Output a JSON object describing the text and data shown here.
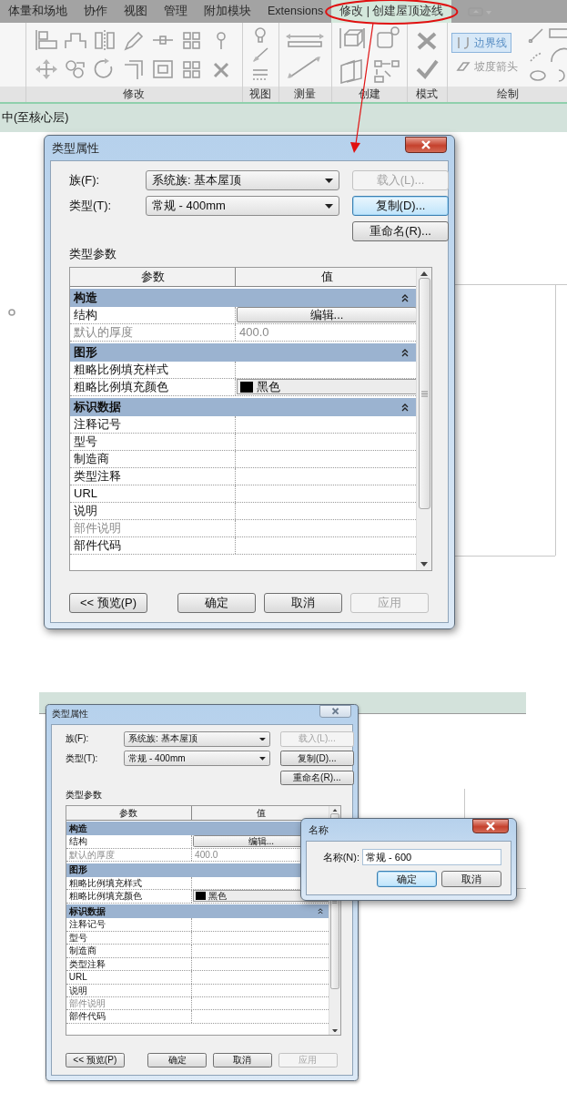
{
  "ribbon": {
    "tabs": [
      {
        "label": "体量和场地",
        "selected": false
      },
      {
        "label": "协作",
        "selected": false
      },
      {
        "label": "视图",
        "selected": false
      },
      {
        "label": "管理",
        "selected": false
      },
      {
        "label": "附加模块",
        "selected": false
      },
      {
        "label": "Extensions",
        "selected": false
      },
      {
        "label": "修改 | 创建屋顶迹线",
        "selected": true
      }
    ],
    "groups": [
      {
        "kind": "modify",
        "label": "修改"
      },
      {
        "kind": "view",
        "label": "视图"
      },
      {
        "kind": "measure",
        "label": "测量"
      },
      {
        "kind": "create",
        "label": "创建"
      },
      {
        "kind": "mode",
        "label": "模式"
      },
      {
        "kind": "draw",
        "label": "绘制"
      }
    ],
    "draw_tools": [
      {
        "label": "边界线",
        "selected": true
      },
      {
        "label": "坡度箭头",
        "selected": false
      }
    ]
  },
  "options_bar": {
    "text": "中(至核心层)"
  },
  "dialogs": [
    {
      "title": "类型属性",
      "active": true,
      "family": {
        "label": "族(F):",
        "value": "系统族: 基本屋顶"
      },
      "type": {
        "label": "类型(T):",
        "value": "常规 - 400mm"
      },
      "side_buttons": [
        {
          "label": "载入(L)...",
          "disabled": true,
          "focused": false
        },
        {
          "label": "复制(D)...",
          "disabled": false,
          "focused": true
        },
        {
          "label": "重命名(R)...",
          "disabled": false,
          "focused": false
        }
      ],
      "params_label": "类型参数",
      "columns": [
        "参数",
        "值"
      ],
      "sections": [
        {
          "name": "构造",
          "expanded": true,
          "rows": [
            {
              "name": "结构",
              "kind": "button",
              "value": "编辑...",
              "disabled": false
            },
            {
              "name": "默认的厚度",
              "kind": "text",
              "value": "400.0",
              "disabled": true
            }
          ]
        },
        {
          "name": "图形",
          "expanded": true,
          "rows": [
            {
              "name": "粗略比例填充样式",
              "kind": "text",
              "disabled": false
            },
            {
              "name": "粗略比例填充颜色",
              "kind": "color",
              "value": "黑色",
              "color": "#000000",
              "disabled": false
            }
          ]
        },
        {
          "name": "标识数据",
          "expanded": true,
          "rows": [
            {
              "name": "注释记号",
              "kind": "text",
              "disabled": false
            },
            {
              "name": "型号",
              "kind": "text",
              "disabled": false
            },
            {
              "name": "制造商",
              "kind": "text",
              "disabled": false
            },
            {
              "name": "类型注释",
              "kind": "text",
              "disabled": false
            },
            {
              "name": "URL",
              "kind": "text",
              "disabled": false
            },
            {
              "name": "说明",
              "kind": "text",
              "disabled": false
            },
            {
              "name": "部件说明",
              "kind": "text",
              "disabled": true
            },
            {
              "name": "部件代码",
              "kind": "text",
              "disabled": false
            }
          ]
        }
      ],
      "footer_buttons": [
        {
          "label": "<< 预览(P)",
          "disabled": false
        },
        {
          "label": "确定",
          "disabled": false
        },
        {
          "label": "取消",
          "disabled": false
        },
        {
          "label": "应用",
          "disabled": true
        }
      ]
    },
    {
      "title": "类型属性",
      "active": false,
      "family": {
        "label": "族(F):",
        "value": "系统族: 基本屋顶"
      },
      "type": {
        "label": "类型(T):",
        "value": "常规 - 400mm"
      },
      "side_buttons": [
        {
          "label": "载入(L)...",
          "disabled": true,
          "focused": false
        },
        {
          "label": "复制(D)...",
          "disabled": false,
          "focused": false
        },
        {
          "label": "重命名(R)...",
          "disabled": false,
          "focused": false
        }
      ],
      "params_label": "类型参数",
      "columns": [
        "参数",
        "值"
      ],
      "sections": [
        {
          "name": "构造",
          "rows": [
            {
              "name": "结构",
              "kind": "button",
              "value": "编辑...",
              "disabled": false
            },
            {
              "name": "默认的厚度",
              "kind": "text",
              "value": "400.0",
              "disabled": true
            }
          ]
        },
        {
          "name": "图形",
          "rows": [
            {
              "name": "粗略比例填充样式",
              "kind": "text",
              "disabled": false
            },
            {
              "name": "粗略比例填充颜色",
              "kind": "color",
              "value": "黑色",
              "color": "#000000",
              "disabled": false
            }
          ]
        },
        {
          "name": "标识数据",
          "expanded": true,
          "rows": [
            {
              "name": "注释记号",
              "kind": "text",
              "disabled": false
            },
            {
              "name": "型号",
              "kind": "text",
              "disabled": false
            },
            {
              "name": "制造商",
              "kind": "text",
              "disabled": false
            },
            {
              "name": "类型注释",
              "kind": "text",
              "disabled": false
            },
            {
              "name": "URL",
              "kind": "text",
              "disabled": false
            },
            {
              "name": "说明",
              "kind": "text",
              "disabled": false
            },
            {
              "name": "部件说明",
              "kind": "text",
              "disabled": true
            },
            {
              "name": "部件代码",
              "kind": "text",
              "disabled": false
            }
          ]
        }
      ],
      "footer_buttons": [
        {
          "label": "<< 预览(P)",
          "disabled": false
        },
        {
          "label": "确定",
          "disabled": false
        },
        {
          "label": "取消",
          "disabled": false
        },
        {
          "label": "应用",
          "disabled": true
        }
      ]
    }
  ],
  "name_dialog": {
    "title": "名称",
    "active": true,
    "label": "名称(N):",
    "value": "常规 - 600",
    "buttons": [
      {
        "label": "确定",
        "focused": true
      },
      {
        "label": "取消",
        "focused": false
      }
    ]
  }
}
